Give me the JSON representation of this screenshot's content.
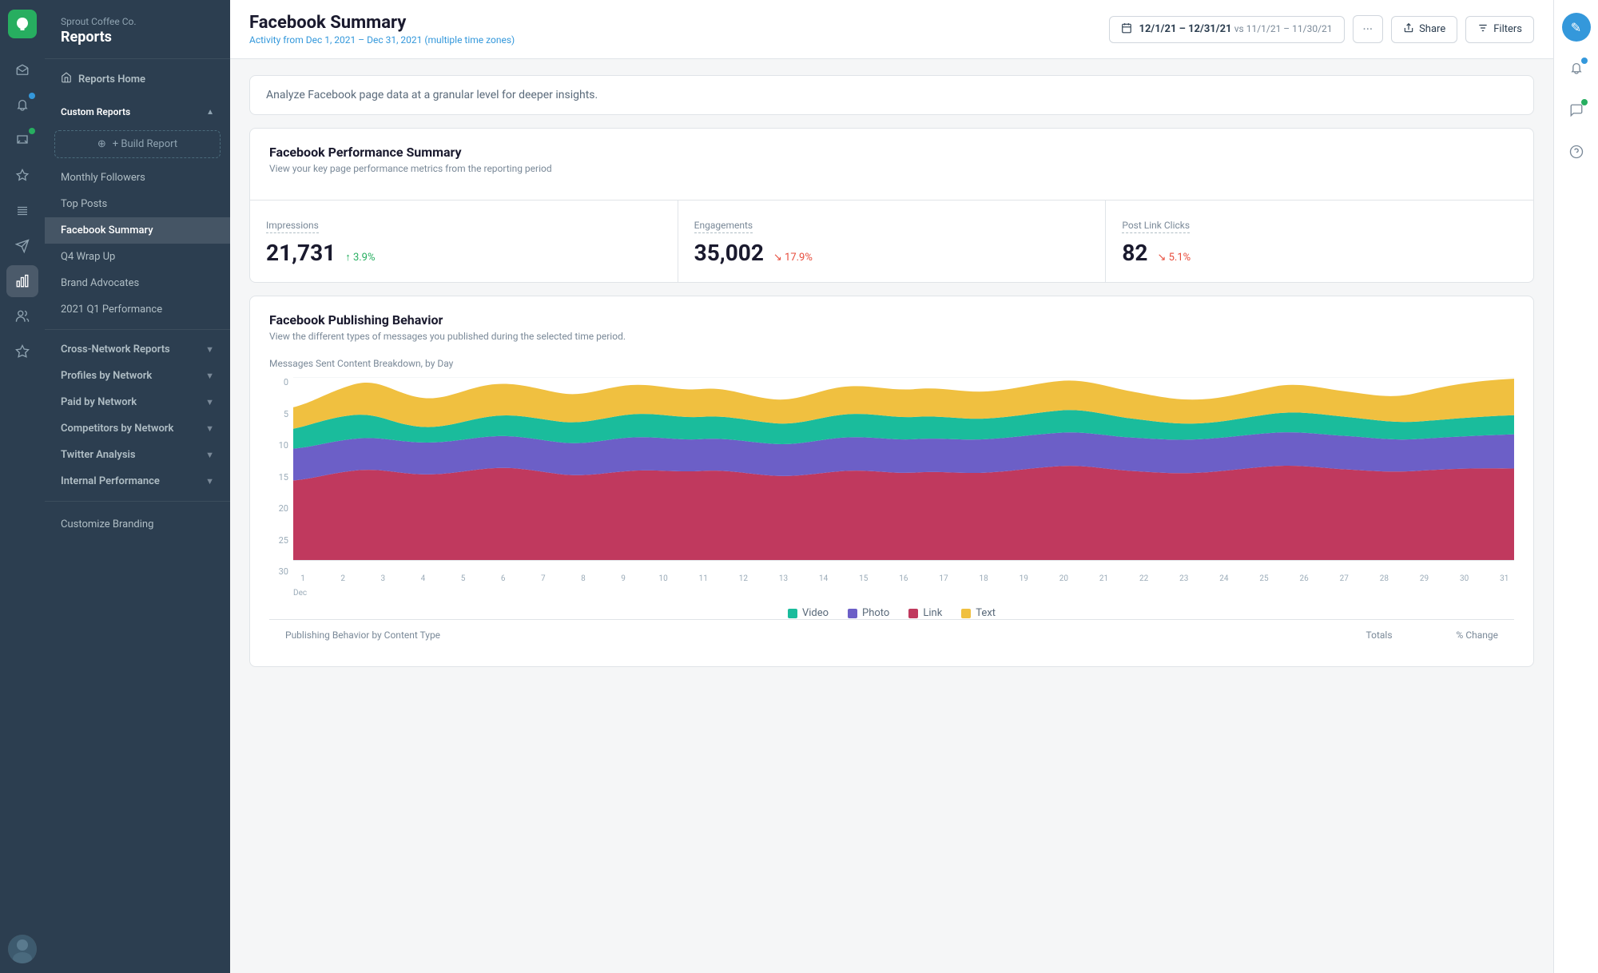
{
  "app": {
    "company": "Sprout Coffee Co.",
    "section": "Reports"
  },
  "sidebar": {
    "top_nav": [
      {
        "icon": "home",
        "label": "Home"
      },
      {
        "icon": "bell",
        "label": "Notifications",
        "badge": "blue"
      },
      {
        "icon": "chat",
        "label": "Messages",
        "badge": "green"
      },
      {
        "icon": "pin",
        "label": "Pin"
      },
      {
        "icon": "list",
        "label": "List"
      },
      {
        "icon": "send",
        "label": "Publishing"
      },
      {
        "icon": "bar-chart",
        "label": "Reports",
        "active": true
      },
      {
        "icon": "people",
        "label": "People"
      },
      {
        "icon": "star",
        "label": "Star"
      }
    ],
    "reports_home": "Reports Home",
    "custom_reports": "Custom Reports",
    "build_report": "+ Build Report",
    "custom_items": [
      {
        "label": "Monthly Followers",
        "active": false
      },
      {
        "label": "Top Posts",
        "active": false
      },
      {
        "label": "Facebook Summary",
        "active": true
      },
      {
        "label": "Q4 Wrap Up",
        "active": false
      },
      {
        "label": "Brand Advocates",
        "active": false
      },
      {
        "label": "2021 Q1 Performance",
        "active": false
      }
    ],
    "cross_network": "Cross-Network Reports",
    "profiles_by_network": "Profiles by Network",
    "paid_by_network": "Paid by Network",
    "competitors_by_network": "Competitors by Network",
    "twitter_analysis": "Twitter Analysis",
    "internal_performance": "Internal Performance",
    "customize_branding": "Customize Branding"
  },
  "header": {
    "title": "Facebook Summary",
    "activity": "Activity from Dec 1, 2021 – Dec 31, 2021",
    "timezone_label": "multiple",
    "timezone_suffix": " time zones)",
    "timezone_prefix": "(",
    "date_range": "12/1/21 – 12/31/21",
    "vs_range": "vs 11/1/21 – 11/30/21",
    "dots_label": "···",
    "share_label": "Share",
    "filters_label": "Filters"
  },
  "intro_card": {
    "text": "Analyze Facebook page data at a granular level for deeper insights."
  },
  "performance_summary": {
    "title": "Facebook Performance Summary",
    "subtitle": "View your key page performance metrics from the reporting period",
    "metrics": [
      {
        "label": "Impressions",
        "value": "21,731",
        "change": "3.9%",
        "direction": "up"
      },
      {
        "label": "Engagements",
        "value": "35,002",
        "change": "17.9%",
        "direction": "down"
      },
      {
        "label": "Post Link Clicks",
        "value": "82",
        "change": "5.1%",
        "direction": "down"
      }
    ]
  },
  "publishing_behavior": {
    "title": "Facebook Publishing Behavior",
    "subtitle": "View the different types of messages you published during the selected time period.",
    "chart_label": "Messages Sent Content Breakdown, by Day",
    "y_labels": [
      "0",
      "5",
      "10",
      "15",
      "20",
      "25",
      "30"
    ],
    "x_labels": [
      "1",
      "2",
      "3",
      "4",
      "5",
      "6",
      "7",
      "8",
      "9",
      "10",
      "11",
      "12",
      "13",
      "14",
      "15",
      "16",
      "17",
      "18",
      "19",
      "20",
      "21",
      "22",
      "23",
      "24",
      "25",
      "26",
      "27",
      "28",
      "29",
      "30",
      "31"
    ],
    "x_month": "Dec",
    "legend": [
      {
        "label": "Video",
        "color": "#1abc9c"
      },
      {
        "label": "Photo",
        "color": "#6c5fc7"
      },
      {
        "label": "Link",
        "color": "#c0395e"
      },
      {
        "label": "Text",
        "color": "#f0c040"
      }
    ]
  },
  "publishing_table": {
    "col1": "Publishing Behavior by Content Type",
    "col2": "Totals",
    "col3": "% Change"
  },
  "right_rail": {
    "edit_icon": "✎",
    "bell_icon": "🔔",
    "chat_icon": "💬",
    "help_icon": "?"
  },
  "colors": {
    "sidebar_bg": "#2a3a4a",
    "accent_blue": "#3498db",
    "accent_green": "#27ae60",
    "chart_video": "#1abc9c",
    "chart_photo": "#6c5fc7",
    "chart_link": "#c0395e",
    "chart_text": "#f0c040"
  }
}
